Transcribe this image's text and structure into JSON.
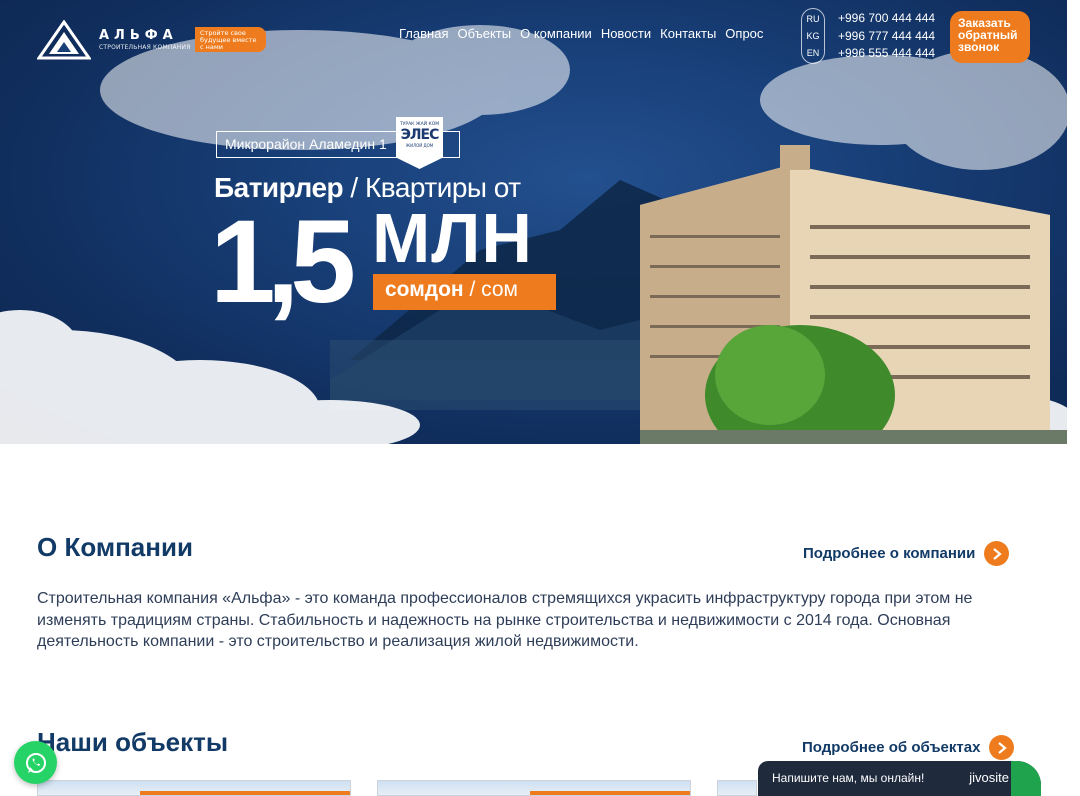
{
  "header": {
    "logo": {
      "name": "АЛЬФА",
      "subtitle": "СТРОИТЕЛЬНАЯ КОМПАНИЯ",
      "tagline": "Стройте свое будущее вместе с нами"
    },
    "nav": [
      "Главная",
      "Объекты",
      "О компании",
      "Новости",
      "Контакты",
      "Опрос"
    ],
    "languages": [
      "RU",
      "KG",
      "EN"
    ],
    "phones": [
      "+996 700 444 444",
      "+996 777 444 444",
      "+996 555 444 444"
    ],
    "callback_label": "Заказать обратный звонок"
  },
  "hero": {
    "district": "Микрорайон Аламедин 1",
    "badge": {
      "top": "ТУРАК ЖАЙ КОМ",
      "main": "ЭЛЕС",
      "bottom": "ЖИЛОЙ ДОМ"
    },
    "headline_bold": "Батирлер",
    "headline_rest": " / Квартиры от",
    "price": "1,5",
    "unit": "МЛН",
    "currency_bold": "сомдон",
    "currency_rest": " / сом"
  },
  "about": {
    "title": "О Компании",
    "link": "Подробнее о компании",
    "text": "Строительная компания «Альфа» - это команда профессионалов стремящихся украсить инфраструктуру города при этом не изменять традициям страны. Стабильность и надежность на рынке строительства и недвижимости с 2014 года. Основная деятельность компании - это строительство и реализация жилой недвижимости."
  },
  "objects": {
    "title": "Наши объекты",
    "link": "Подробнее об объектах"
  },
  "chat": {
    "text": "Напишите нам, мы онлайн!",
    "brand": "jivosite"
  },
  "colors": {
    "accent": "#ee7c1e",
    "primary": "#123a66",
    "hero_bg": "#183f78"
  }
}
